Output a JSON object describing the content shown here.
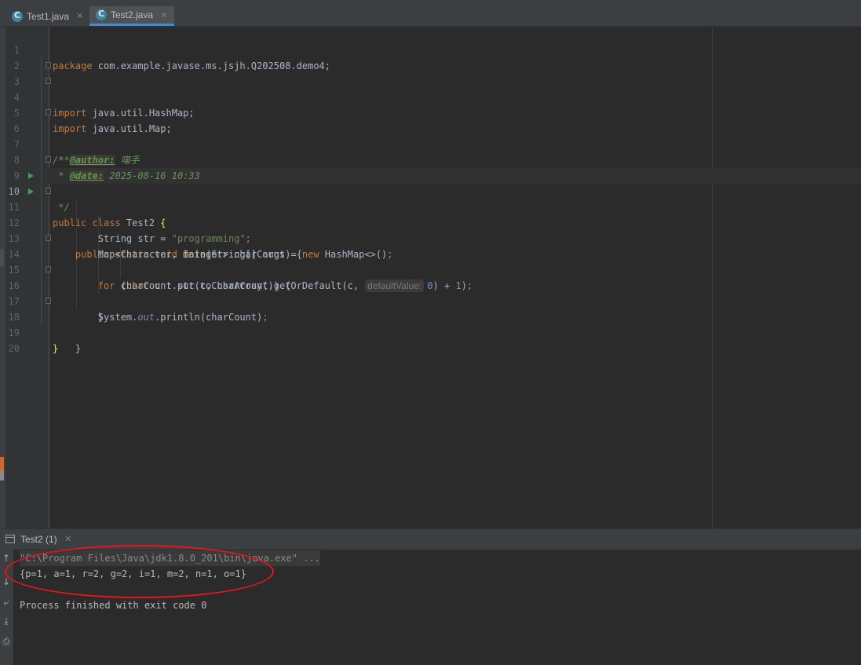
{
  "tabs": [
    {
      "label": "Test1.java",
      "icon": "java-class-icon",
      "active": false
    },
    {
      "label": "Test2.java",
      "icon": "java-class-icon",
      "active": true
    }
  ],
  "editor": {
    "current_line": 10,
    "lines": [
      {
        "n": "1",
        "text": "package com.example.javase.ms.jsjh.Q202508.demo4;"
      },
      {
        "n": "2",
        "text": ""
      },
      {
        "n": "3",
        "text": "import java.util.HashMap;"
      },
      {
        "n": "4",
        "text": "import java.util.Map;"
      },
      {
        "n": "5",
        "text": ""
      },
      {
        "n": "6",
        "text": "/**"
      },
      {
        "n": "7",
        "text": " * @author: 喵手"
      },
      {
        "n": "8",
        "text": " * @date: 2025-08-16 10:33"
      },
      {
        "n": "9",
        "text": " */"
      },
      {
        "n": "10",
        "text": "public class Test2 {"
      },
      {
        "n": "11",
        "text": "    public static void main(String[] args) {"
      },
      {
        "n": "12",
        "text": "        String str = \"programming\";"
      },
      {
        "n": "13",
        "text": "        Map<Character, Integer> charCount = new HashMap<>();"
      },
      {
        "n": "14",
        "text": "        for (char c : str.toCharArray()) {"
      },
      {
        "n": "15",
        "text": "            charCount.put(c, charCount.getOrDefault(c, 0) + 1);",
        "inlay_hint": "defaultValue:"
      },
      {
        "n": "16",
        "text": "        }"
      },
      {
        "n": "17",
        "text": "        System.out.println(charCount);"
      },
      {
        "n": "18",
        "text": "    }"
      },
      {
        "n": "19",
        "text": "}"
      },
      {
        "n": "20",
        "text": ""
      }
    ]
  },
  "run_panel": {
    "title": "Test2 (1)",
    "command": "\"C:\\Program Files\\Java\\jdk1.8.0_201\\bin\\java.exe\" ...",
    "output": "{p=1, a=1, r=2, g=2, i=1, m=2, n=1, o=1}",
    "exit_message": "Process finished with exit code 0",
    "annotation_color": "#e8151b"
  },
  "colors": {
    "keyword": "#cc7832",
    "string": "#6a8759",
    "number": "#6897bb",
    "method": "#ffc66d",
    "doc_comment": "#629755",
    "static_field": "#9876aa",
    "text": "#a9b7c6"
  }
}
